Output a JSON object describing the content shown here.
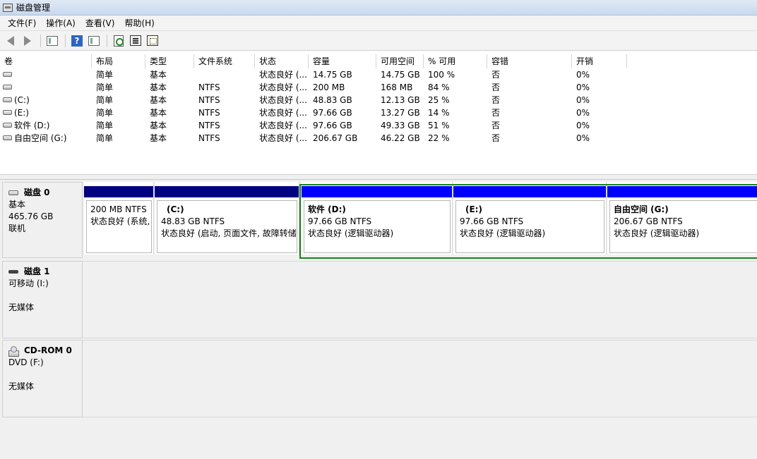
{
  "window": {
    "title": "磁盘管理"
  },
  "menu": [
    "文件(F)",
    "操作(A)",
    "查看(V)",
    "帮助(H)"
  ],
  "toolbar": {
    "icons": [
      "back-arrow-icon",
      "forward-arrow-icon",
      "console-tree-icon",
      "help-icon",
      "show-hide-pane-icon",
      "refresh-icon",
      "properties-icon",
      "view-icon"
    ]
  },
  "volume_table": {
    "headers": [
      "卷",
      "布局",
      "类型",
      "文件系统",
      "状态",
      "容量",
      "可用空间",
      "% 可用",
      "容错",
      "开销"
    ],
    "rows": [
      [
        "",
        "简单",
        "基本",
        "",
        "状态良好 (...",
        "14.75 GB",
        "14.75 GB",
        "100 %",
        "否",
        "0%"
      ],
      [
        "",
        "简单",
        "基本",
        "NTFS",
        "状态良好 (...",
        "200 MB",
        "168 MB",
        "84 %",
        "否",
        "0%"
      ],
      [
        "(C:)",
        "简单",
        "基本",
        "NTFS",
        "状态良好 (...",
        "48.83 GB",
        "12.13 GB",
        "25 %",
        "否",
        "0%"
      ],
      [
        "(E:)",
        "简单",
        "基本",
        "NTFS",
        "状态良好 (...",
        "97.66 GB",
        "13.27 GB",
        "14 %",
        "否",
        "0%"
      ],
      [
        "软件 (D:)",
        "简单",
        "基本",
        "NTFS",
        "状态良好 (...",
        "97.66 GB",
        "49.33 GB",
        "51 %",
        "否",
        "0%"
      ],
      [
        "自由空间 (G:)",
        "简单",
        "基本",
        "NTFS",
        "状态良好 (...",
        "206.67 GB",
        "46.22 GB",
        "22 %",
        "否",
        "0%"
      ]
    ]
  },
  "disks": {
    "disk0": {
      "name": "磁盘 0",
      "type": "基本",
      "size": "465.76 GB",
      "state": "联机",
      "partitions": [
        {
          "name": "",
          "size": "200 MB NTFS",
          "status": "状态良好 (系统,",
          "bar_color": "#000080"
        },
        {
          "name": "(C:)",
          "size": "48.83 GB NTFS",
          "status": "状态良好 (启动, 页面文件, 故障转储",
          "bar_color": "#000080"
        },
        {
          "name": "软件  (D:)",
          "size": "97.66 GB NTFS",
          "status": "状态良好 (逻辑驱动器)",
          "bar_color": "#0000ff"
        },
        {
          "name": "(E:)",
          "size": "97.66 GB NTFS",
          "status": "状态良好 (逻辑驱动器)",
          "bar_color": "#0000ff"
        },
        {
          "name": "自由空间  (G:)",
          "size": "206.67 GB NTFS",
          "status": "状态良好 (逻辑驱动器)",
          "bar_color": "#0000ff"
        }
      ]
    },
    "disk1": {
      "name": "磁盘 1",
      "type": "可移动 (I:)",
      "state": "无媒体"
    },
    "cdrom0": {
      "name": "CD-ROM 0",
      "type": "DVD (F:)",
      "state": "无媒体"
    }
  }
}
